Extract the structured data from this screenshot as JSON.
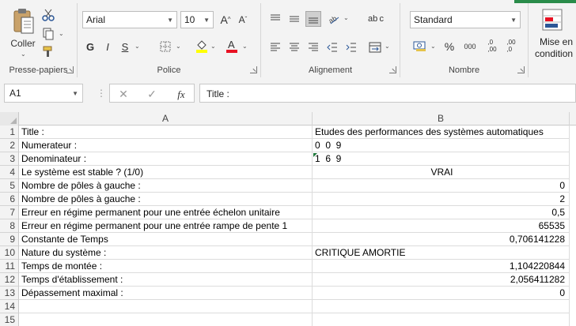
{
  "ribbon": {
    "clipboard": {
      "label": "Presse-papiers",
      "paste_label": "Coller"
    },
    "font": {
      "label": "Police",
      "font_name": "Arial",
      "font_size": "10",
      "bold": "G",
      "italic": "I",
      "underline": "S"
    },
    "alignment": {
      "label": "Alignement"
    },
    "number": {
      "label": "Nombre",
      "format": "Standard",
      "percent": "%",
      "thousands": "000",
      "dec_increase": ",0\n,00",
      "dec_decrease": ",00\n,0"
    },
    "cells": {
      "label_line1": "Mise en",
      "label_line2": "condition"
    },
    "icons": {
      "wrap": "ab c"
    },
    "accent_color": "#2a8c4a"
  },
  "formula_bar": {
    "name_box": "A1",
    "content": "Title :",
    "fx": "fx"
  },
  "columns": [
    "A",
    "B"
  ],
  "rows": [
    {
      "n": "1",
      "a": "Title :",
      "b": "Etudes des performances des systèmes automatiques",
      "align": "left"
    },
    {
      "n": "2",
      "a": "Numerateur :",
      "b": "0  0  9",
      "align": "left"
    },
    {
      "n": "3",
      "a": "Denominateur :",
      "b": "1  6  9",
      "align": "left"
    },
    {
      "n": "4",
      "a": "Le système est stable ? (1/0)",
      "b": "VRAI",
      "align": "center"
    },
    {
      "n": "5",
      "a": "Nombre de pôles à gauche :",
      "b": "0",
      "align": "right"
    },
    {
      "n": "6",
      "a": "Nombre de pôles à gauche :",
      "b": "2",
      "align": "right"
    },
    {
      "n": "7",
      "a": "Erreur en régime permanent pour une entrée échelon unitaire",
      "b": "0,5",
      "align": "right"
    },
    {
      "n": "8",
      "a": "Erreur en régime permanent pour une entrée rampe de pente 1",
      "b": "65535",
      "align": "right"
    },
    {
      "n": "9",
      "a": "Constante de Temps",
      "b": "0,706141228",
      "align": "right"
    },
    {
      "n": "10",
      "a": "Nature du système :",
      "b": "CRITIQUE AMORTIE",
      "align": "left"
    },
    {
      "n": "11",
      "a": "Temps de montée :",
      "b": "1,104220844",
      "align": "right"
    },
    {
      "n": "12",
      "a": "Temps d'établissement :",
      "b": "2,056411282",
      "align": "right"
    },
    {
      "n": "13",
      "a": "Dépassement maximal :",
      "b": "0",
      "align": "right"
    },
    {
      "n": "14",
      "a": "",
      "b": "",
      "align": "left"
    },
    {
      "n": "15",
      "a": "",
      "b": "",
      "align": "left"
    }
  ]
}
